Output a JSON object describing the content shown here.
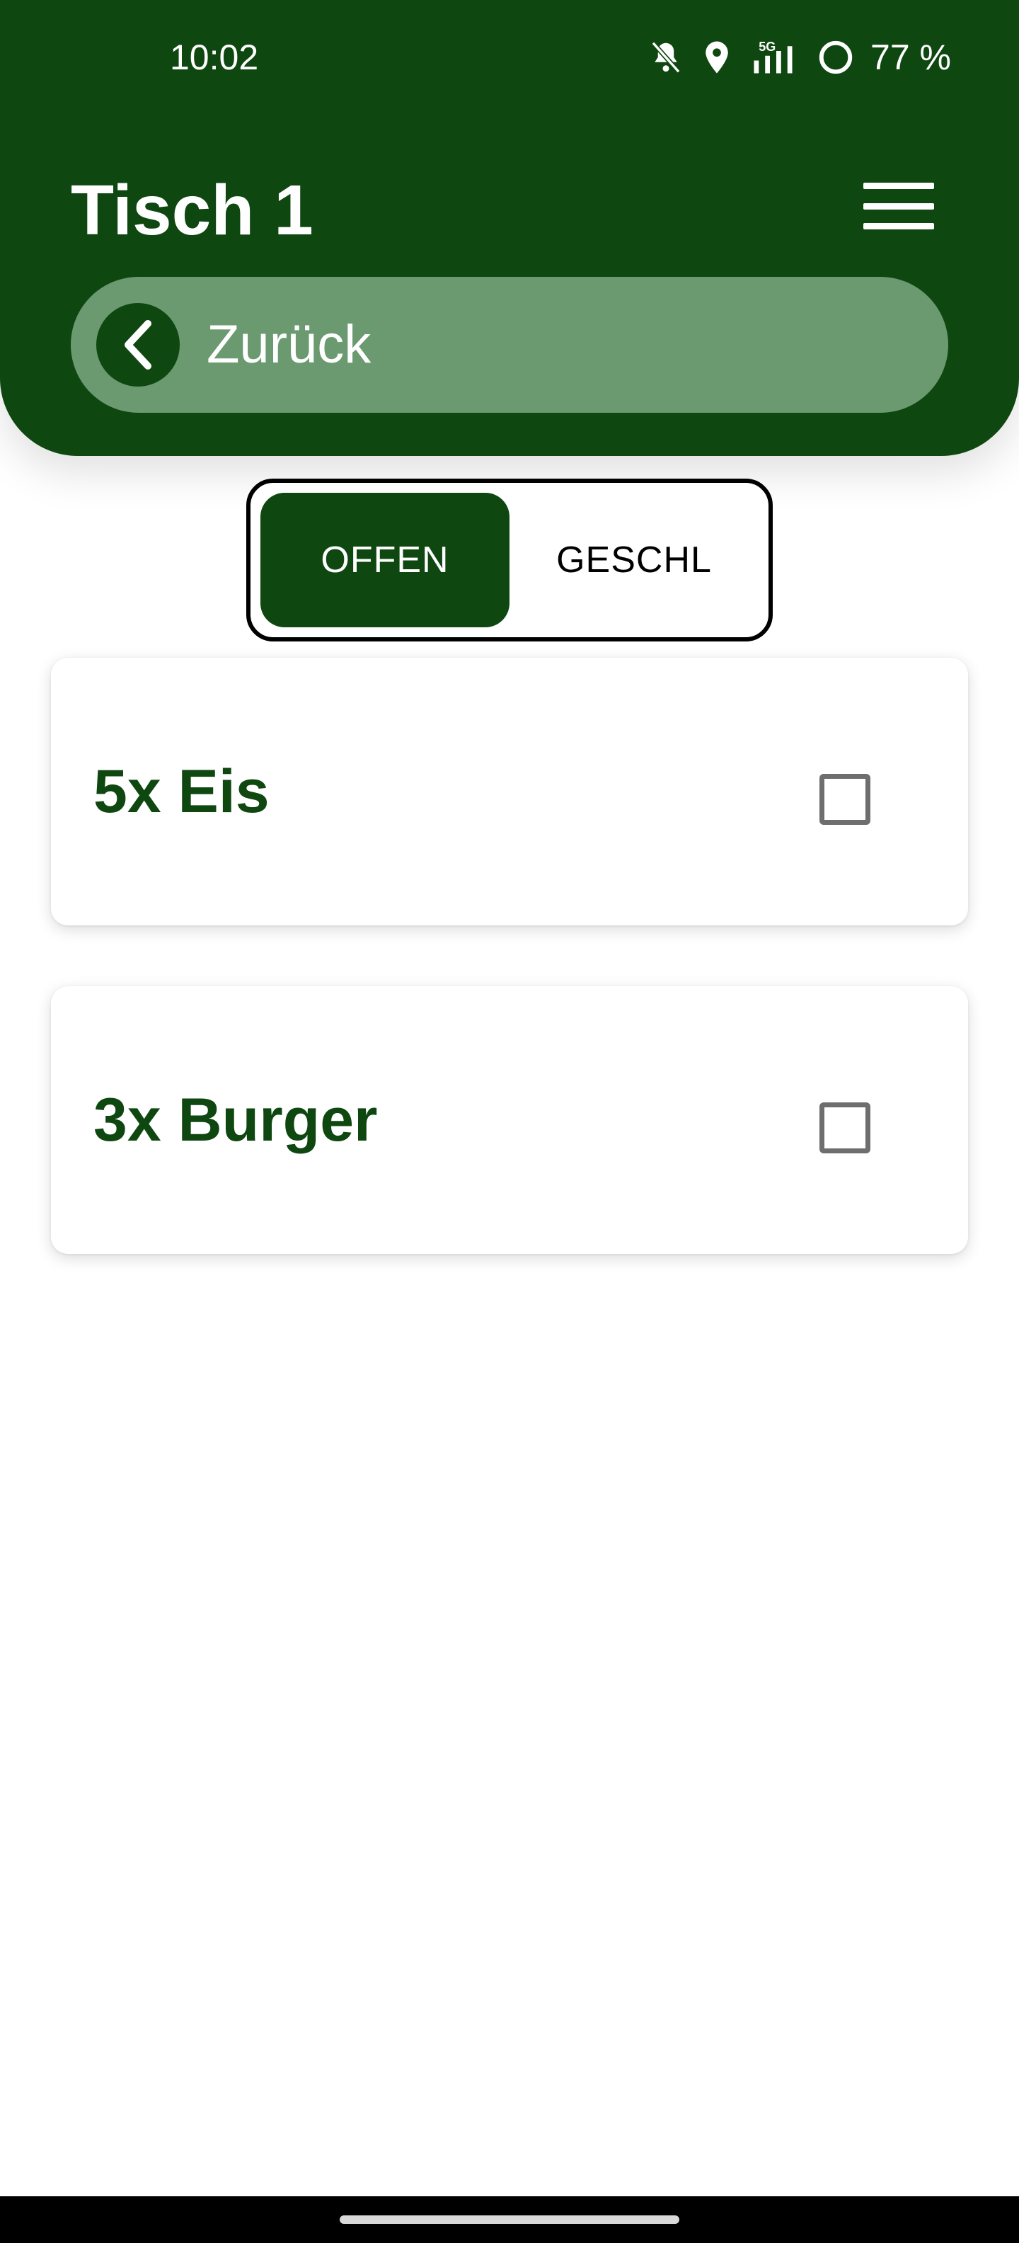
{
  "status_bar": {
    "time": "10:02",
    "network": "5G",
    "battery": "77 %"
  },
  "header": {
    "title": "Tisch 1",
    "back_label": "Zurück",
    "color": "#0f4711",
    "back_bar_color": "#6b9a71"
  },
  "tabs": {
    "open_label": "OFFEN",
    "closed_label": "GESCHL",
    "selected": "OFFEN"
  },
  "orders": [
    {
      "label": "5x Eis",
      "checked": false
    },
    {
      "label": "3x Burger",
      "checked": false
    }
  ],
  "icons": {
    "status": [
      "bell-off-icon",
      "location-pin-icon",
      "signal-5g-icon",
      "battery-ring-icon"
    ],
    "header": [
      "hamburger-menu-icon",
      "chevron-left-icon"
    ]
  }
}
